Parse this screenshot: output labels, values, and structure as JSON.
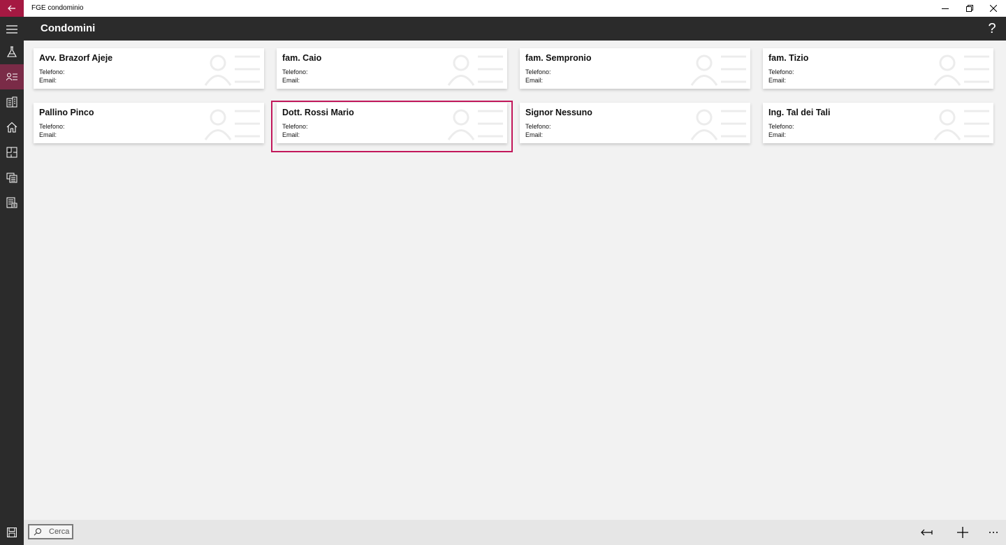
{
  "window": {
    "title": "FGE condominio"
  },
  "header": {
    "title": "Condomini",
    "help": "?"
  },
  "colors": {
    "accent": "#a51942",
    "selection": "#c2185b",
    "chrome": "#2b2b2b"
  },
  "rail": {
    "items": [
      {
        "icon": "hamburger-menu-icon"
      },
      {
        "icon": "flask-icon"
      },
      {
        "icon": "contacts-list-icon",
        "active": true
      },
      {
        "icon": "buildings-icon"
      },
      {
        "icon": "home-icon"
      },
      {
        "icon": "floor-plan-icon"
      },
      {
        "icon": "document-register-icon"
      },
      {
        "icon": "calculator-sheet-icon"
      }
    ],
    "bottom_icon": "save-icon"
  },
  "cards": [
    {
      "name": "Avv. Brazorf Ajeje",
      "phone_label": "Telefono:",
      "email_label": "Email:"
    },
    {
      "name": "fam. Caio",
      "phone_label": "Telefono:",
      "email_label": "Email:"
    },
    {
      "name": "fam. Sempronio",
      "phone_label": "Telefono:",
      "email_label": "Email:"
    },
    {
      "name": "fam. Tizio",
      "phone_label": "Telefono:",
      "email_label": "Email:"
    },
    {
      "name": "Pallino Pinco",
      "phone_label": "Telefono:",
      "email_label": "Email:"
    },
    {
      "name": "Dott. Rossi Mario",
      "phone_label": "Telefono:",
      "email_label": "Email:",
      "selected": true
    },
    {
      "name": "Signor Nessuno",
      "phone_label": "Telefono:",
      "email_label": "Email:"
    },
    {
      "name": "Ing. Tal dei Tali",
      "phone_label": "Telefono:",
      "email_label": "Email:"
    }
  ],
  "bottombar": {
    "search_placeholder": "Cerca",
    "actions": [
      "back-arrow-icon",
      "add-icon",
      "more-icon"
    ]
  }
}
